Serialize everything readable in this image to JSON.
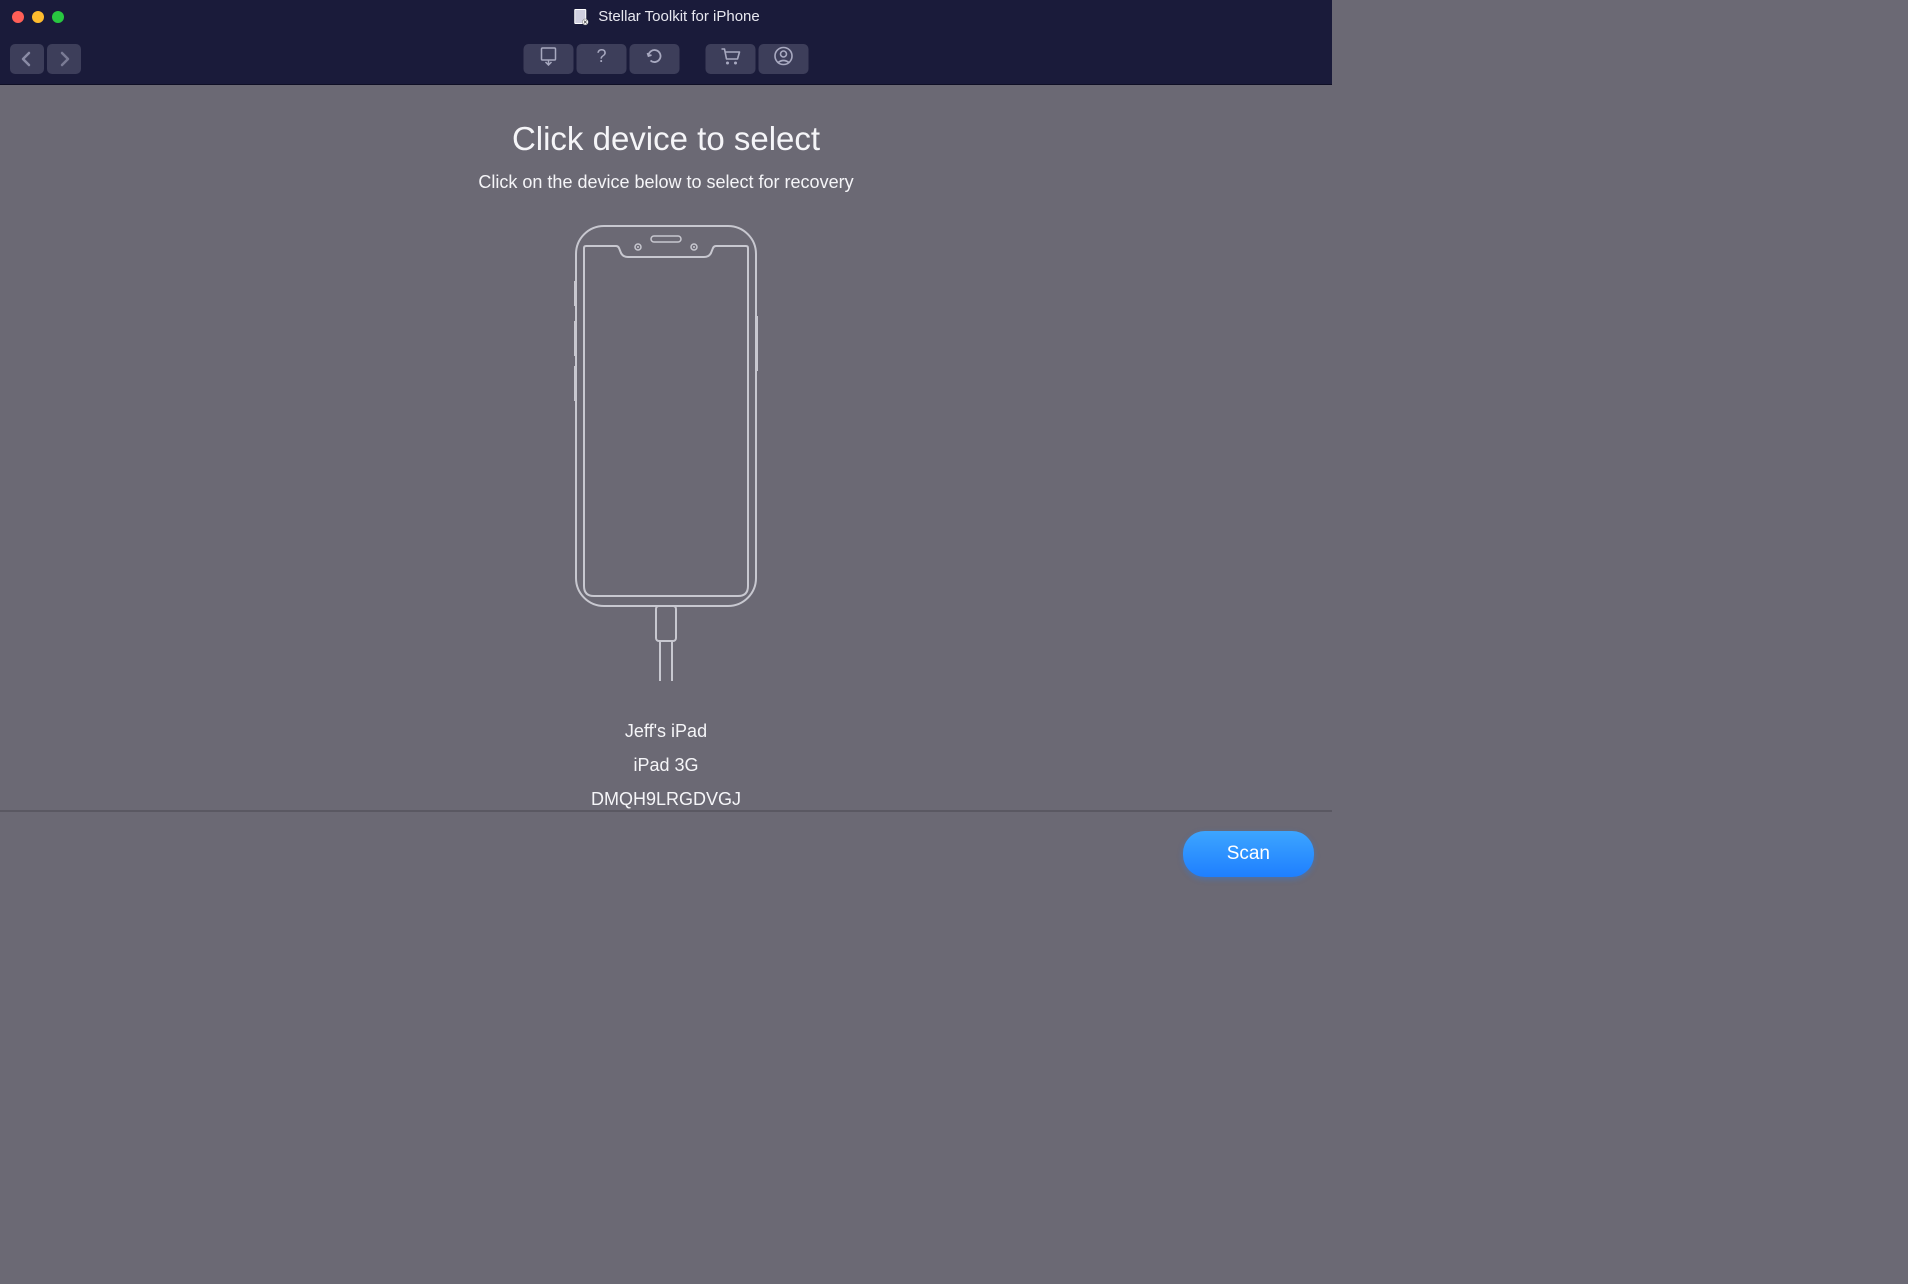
{
  "title": "Stellar Toolkit for iPhone",
  "main": {
    "heading": "Click device to select",
    "subheading": "Click on the device below to select for recovery"
  },
  "device": {
    "name": "Jeff's iPad",
    "model": "iPad 3G",
    "serial": "DMQH9LRGDVGJ"
  },
  "footer": {
    "scan_label": "Scan"
  }
}
